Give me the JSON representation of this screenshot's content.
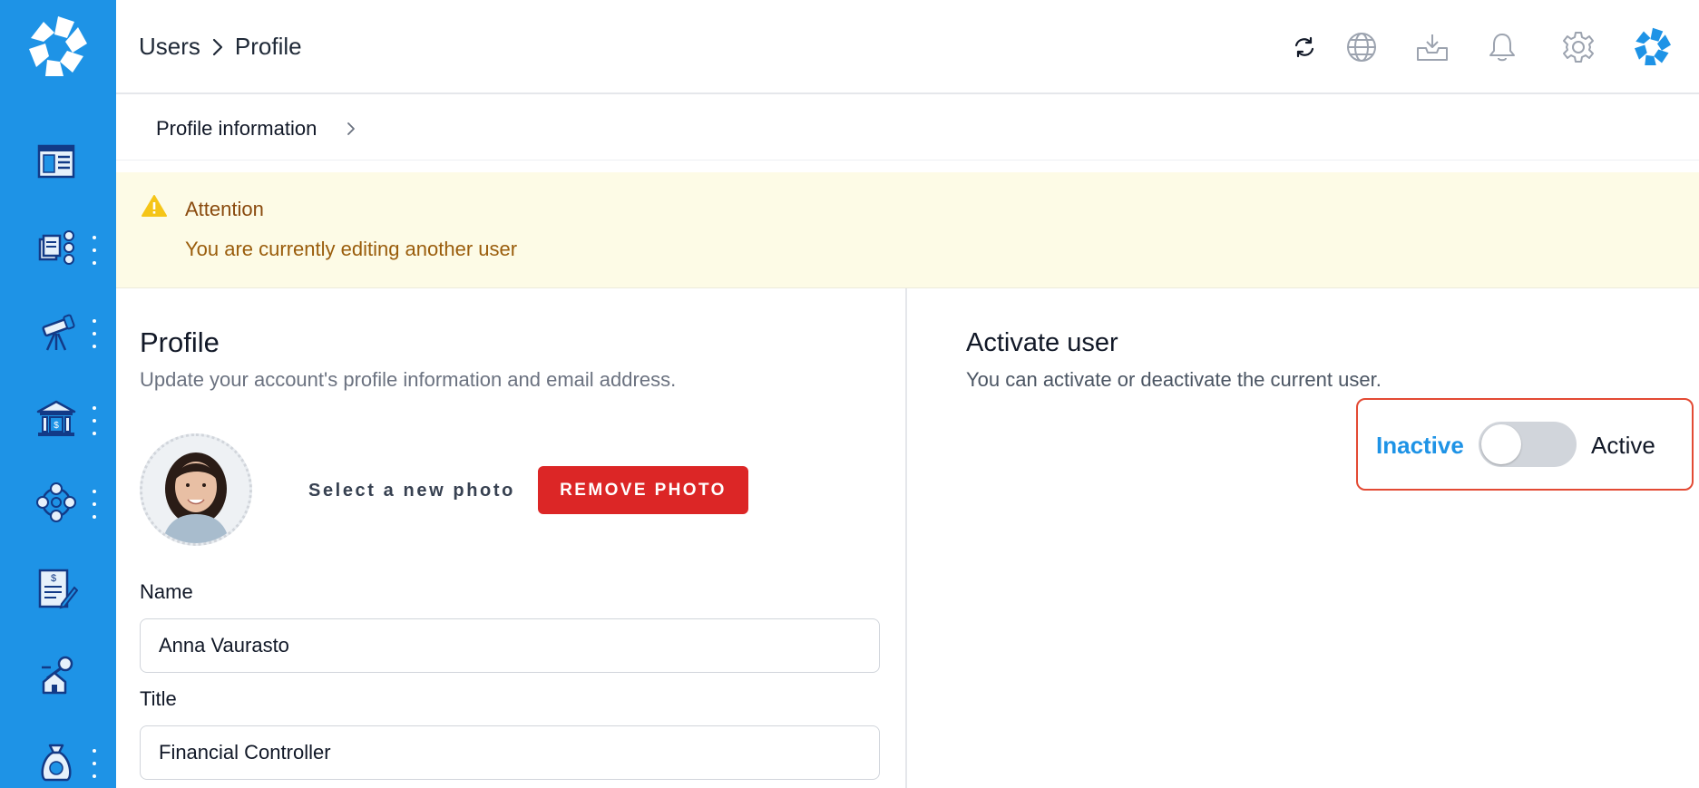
{
  "header": {
    "breadcrumb": [
      "Users",
      "Profile"
    ]
  },
  "tabs": [
    {
      "label": "Profile information"
    }
  ],
  "alert": {
    "title": "Attention",
    "message": "You are currently editing another user"
  },
  "profile": {
    "heading": "Profile",
    "description": "Update your account's profile information and email address.",
    "select_photo_label": "Select a new photo",
    "remove_photo_label": "REMOVE PHOTO",
    "name_label": "Name",
    "name_value": "Anna Vaurasto",
    "title_label": "Title",
    "title_value": "Financial Controller"
  },
  "activate": {
    "heading": "Activate user",
    "description": "You can activate or deactivate the current user.",
    "inactive_label": "Inactive",
    "active_label": "Active",
    "is_active": false
  },
  "icons": {
    "sidebar": [
      "dashboard-icon",
      "documents-currency-icon",
      "telescope-icon",
      "bank-icon",
      "currency-exchange-icon",
      "invoice-edit-icon",
      "property-key-icon",
      "money-bag-icon"
    ],
    "topbar": [
      "refresh-icon",
      "globe-icon",
      "inbox-download-icon",
      "bell-icon",
      "gear-icon",
      "avatar-logo-icon"
    ]
  },
  "colors": {
    "sidebar": "#1e93e6",
    "accent": "#1e93e6",
    "danger": "#dc2626",
    "alert_bg": "#fdfbe6",
    "alert_text": "#9a5d0c",
    "highlight_border": "#e34a34"
  }
}
